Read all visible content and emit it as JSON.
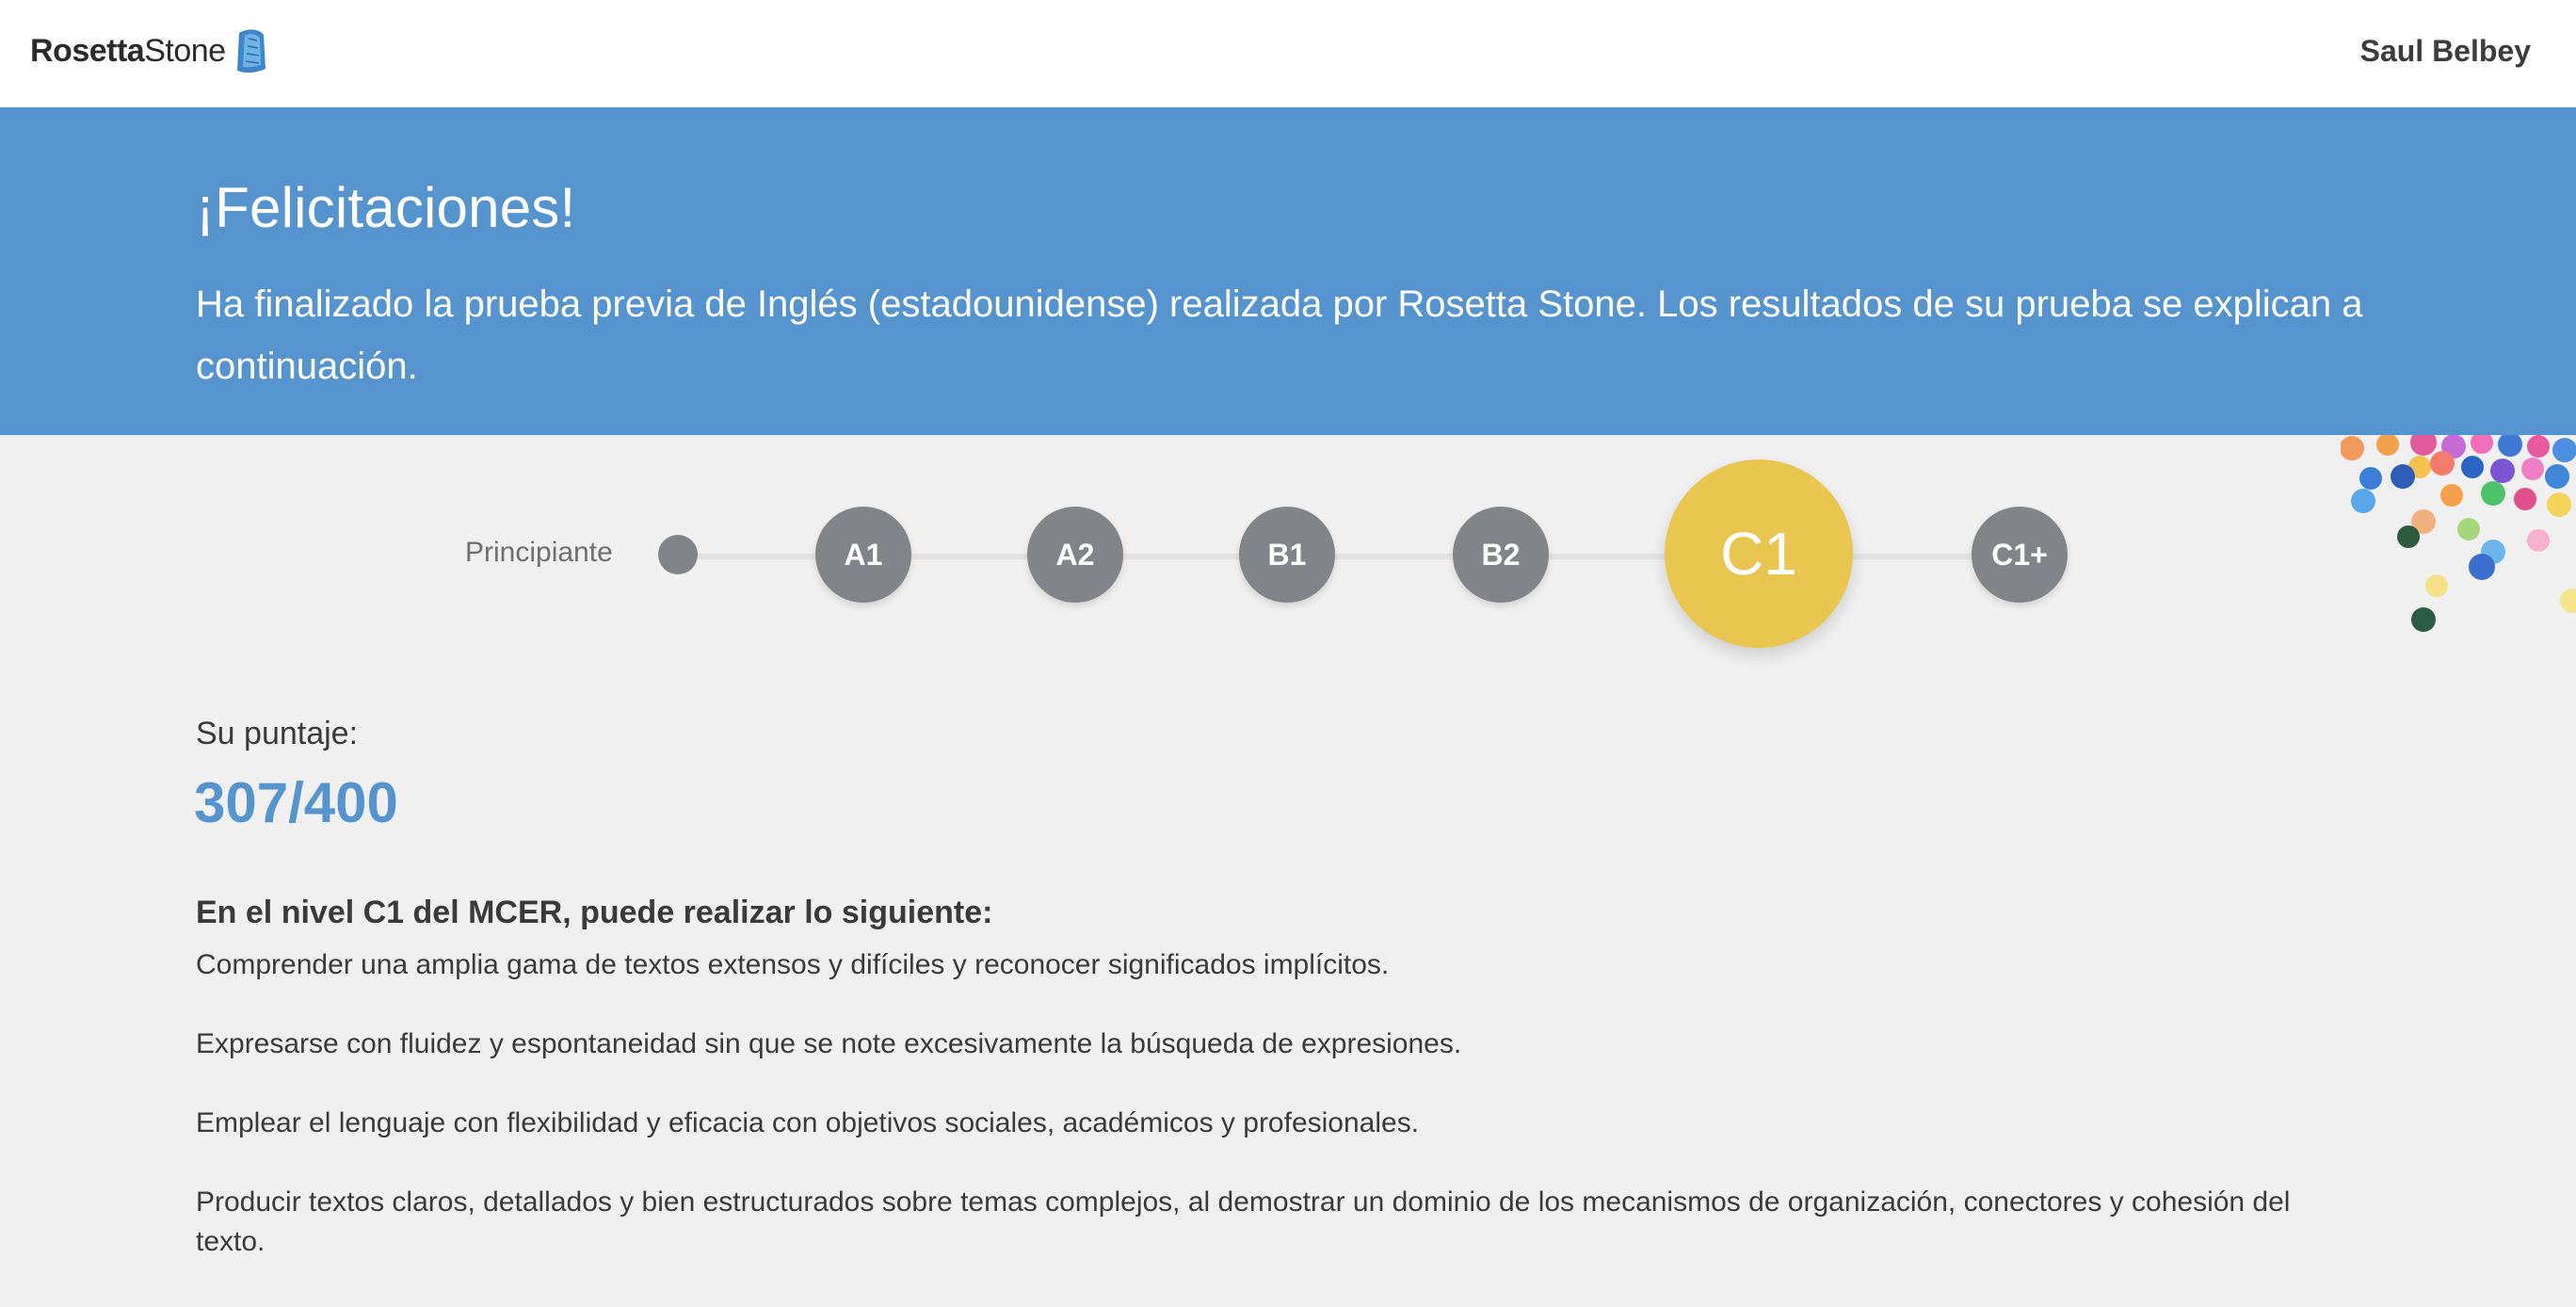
{
  "header": {
    "logo_bold": "Rosetta",
    "logo_light": "Stone",
    "user_name": "Saul Belbey"
  },
  "banner": {
    "title": "¡Felicitaciones!",
    "message": "Ha finalizado la prueba previa de Inglés (estadounidense) realizada por Rosetta Stone. Los resultados de su prueba se explican a continuación."
  },
  "levels": {
    "beginner_label": "Principiante",
    "items": [
      "A1",
      "A2",
      "B1",
      "B2",
      "C1",
      "C1+"
    ],
    "current": "C1"
  },
  "result": {
    "score_label": "Su puntaje:",
    "score_value": "307/400",
    "abilities_heading": "En el nivel C1 del MCER, puede realizar lo siguiente:",
    "abilities": [
      "Comprender una amplia gama de textos extensos y difíciles y reconocer significados implícitos.",
      "Expresarse con fluidez y espontaneidad sin que se note excesivamente la búsqueda de expresiones.",
      "Emplear el lenguaje con flexibilidad y eficacia con objetivos sociales, académicos y profesionales.",
      "Producir textos claros, detallados y bien estructurados sobre temas complejos, al demostrar un dominio de los mecanismos de organización, conectores y cohesión del texto."
    ]
  },
  "colors": {
    "banner_blue": "#5594cf",
    "level_gray": "#818589",
    "current_level_yellow": "#e8c650",
    "score_blue": "#5594cf",
    "background": "#f0f0f0"
  },
  "icons": {
    "logo": "rosetta-stone-logo-icon"
  }
}
